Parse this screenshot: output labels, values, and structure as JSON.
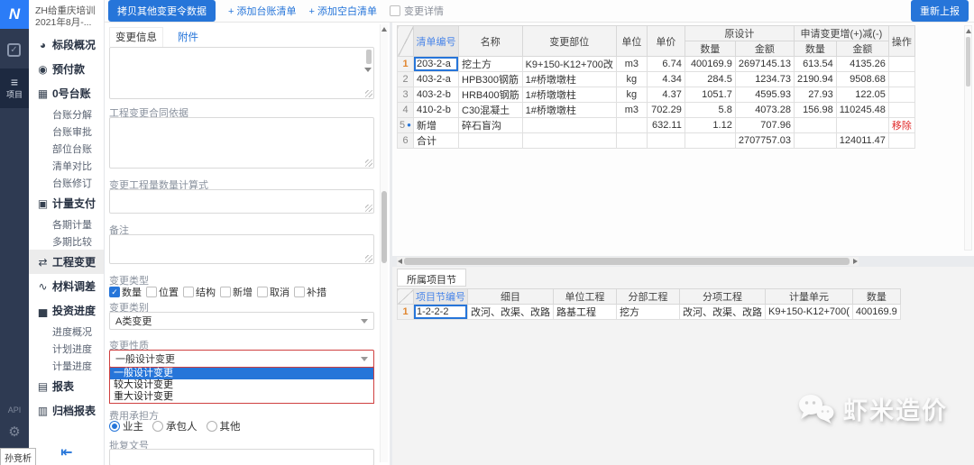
{
  "colors": {
    "accent": "#2675d9",
    "danger": "#e02a2a",
    "active_row_no": "#e0862f"
  },
  "rail": {
    "logo_glyph": "N",
    "project_label": "项目",
    "api_label": "API",
    "user_tooltip": "孙竞析"
  },
  "sidebar": {
    "project_name_line1": "ZH给重庆培训",
    "project_name_line2": "2021年8月-...",
    "items": [
      {
        "id": "section-overview",
        "label": "标段概况",
        "type": "section",
        "icon": "pie-chart-icon",
        "glyph": "◕"
      },
      {
        "id": "advance-payment",
        "label": "预付款",
        "type": "section",
        "icon": "eye-icon",
        "glyph": "◉"
      },
      {
        "id": "ledger-0",
        "label": "0号台账",
        "type": "section",
        "icon": "ledger-icon",
        "glyph": "▦"
      },
      {
        "id": "ledger-breakdown",
        "label": "台账分解",
        "type": "sub"
      },
      {
        "id": "ledger-review",
        "label": "台账审批",
        "type": "sub"
      },
      {
        "id": "part-ledger",
        "label": "部位台账",
        "type": "sub"
      },
      {
        "id": "list-compare",
        "label": "清单对比",
        "type": "sub"
      },
      {
        "id": "ledger-revision",
        "label": "台账修订",
        "type": "sub"
      },
      {
        "id": "measurement-payment",
        "label": "计量支付",
        "type": "section",
        "icon": "calendar-icon",
        "glyph": "▣"
      },
      {
        "id": "period-measurement",
        "label": "各期计量",
        "type": "sub"
      },
      {
        "id": "multi-period-compare",
        "label": "多期比较",
        "type": "sub"
      },
      {
        "id": "engineering-change",
        "label": "工程变更",
        "type": "section",
        "icon": "swap-icon",
        "glyph": "⇄",
        "active": true
      },
      {
        "id": "material-adjustment",
        "label": "材料调差",
        "type": "section",
        "icon": "line-chart-icon",
        "glyph": "∿"
      },
      {
        "id": "investment-progress",
        "label": "投资进度",
        "type": "section",
        "icon": "bar-chart-icon",
        "glyph": "▅"
      },
      {
        "id": "progress-overview",
        "label": "进度概况",
        "type": "sub"
      },
      {
        "id": "plan-progress",
        "label": "计划进度",
        "type": "sub"
      },
      {
        "id": "measurement-progress",
        "label": "计量进度",
        "type": "sub"
      },
      {
        "id": "reports",
        "label": "报表",
        "type": "section",
        "icon": "report-icon",
        "glyph": "▤"
      },
      {
        "id": "archived-reports",
        "label": "归档报表",
        "type": "section",
        "icon": "archive-icon",
        "glyph": "▥"
      }
    ]
  },
  "toolbar": {
    "copy_button": "拷贝其他变更令数据",
    "add_ledger_link": "+ 添加台账清单",
    "add_blank_link": "+ 添加空白清单",
    "detail_checkbox": "变更详情",
    "resubmit_button": "重新上报"
  },
  "form": {
    "tabs": {
      "info": "变更信息",
      "attachment": "附件"
    },
    "contract_basis_label": "工程变更合同依据",
    "quantity_formula_label": "变更工程量数量计算式",
    "remark_label": "备注",
    "change_type_label": "变更类型",
    "change_types": [
      {
        "label": "数量",
        "checked": true
      },
      {
        "label": "位置",
        "checked": false
      },
      {
        "label": "结构",
        "checked": false
      },
      {
        "label": "新增",
        "checked": false
      },
      {
        "label": "取消",
        "checked": false
      },
      {
        "label": "补措",
        "checked": false
      }
    ],
    "change_category_label": "变更类别",
    "change_category_value": "A类变更",
    "change_nature_label": "变更性质",
    "change_nature_value": "一般设计变更",
    "change_nature_options": [
      {
        "label": "一般设计变更",
        "selected": true
      },
      {
        "label": "较大设计变更",
        "selected": false
      },
      {
        "label": "重大设计变更",
        "selected": false
      }
    ],
    "cost_bearer_label": "费用承担方",
    "cost_bearers": [
      {
        "label": "业主",
        "selected": true
      },
      {
        "label": "承包人",
        "selected": false
      },
      {
        "label": "其他",
        "selected": false
      }
    ],
    "approval_no_label": "批复文号",
    "approval_no_value": ""
  },
  "list_table": {
    "group_headers": {
      "original": "原设计",
      "requested": "申请变更增(+)减(-)"
    },
    "headers": [
      "清单编号",
      "名称",
      "变更部位",
      "单位",
      "单价",
      "数量",
      "金额",
      "数量",
      "金额",
      "操作"
    ],
    "rows": [
      {
        "no": "1",
        "active": true,
        "selected_cell": 0,
        "cells": [
          "203-2-a",
          "挖土方",
          "K9+150-K12+700改",
          "m3",
          "6.74",
          "400169.9",
          "2697145.13",
          "613.54",
          "4135.26",
          ""
        ]
      },
      {
        "no": "2",
        "cells": [
          "403-2-a",
          "HPB300钢筋",
          "1#桥墩墩柱",
          "kg",
          "4.34",
          "284.5",
          "1234.73",
          "2190.94",
          "9508.68",
          ""
        ]
      },
      {
        "no": "3",
        "cells": [
          "403-2-b",
          "HRB400钢筋",
          "1#桥墩墩柱",
          "kg",
          "4.37",
          "1051.7",
          "4595.93",
          "27.93",
          "122.05",
          ""
        ]
      },
      {
        "no": "4",
        "cells": [
          "410-2-b",
          "C30混凝土",
          "1#桥墩墩柱",
          "m3",
          "702.29",
          "5.8",
          "4073.28",
          "156.98",
          "110245.48",
          ""
        ]
      },
      {
        "no": "5",
        "dot": true,
        "remove": true,
        "cells": [
          "新增",
          "碎石盲沟",
          "",
          "",
          "632.11",
          "1.12",
          "707.96",
          "",
          "",
          "移除"
        ]
      },
      {
        "no": "6",
        "cells": [
          "合计",
          "",
          "",
          "",
          "",
          "",
          "2707757.03",
          "",
          "124011.47",
          ""
        ]
      }
    ]
  },
  "project_node": {
    "tab": "所属项目节",
    "headers": [
      "项目节编号",
      "细目",
      "单位工程",
      "分部工程",
      "分项工程",
      "计量单元",
      "数量"
    ],
    "rows": [
      {
        "no": "1",
        "active": true,
        "selected_cell": 0,
        "cells": [
          "1-2-2-2",
          "改河、改渠、改路",
          "路基工程",
          "挖方",
          "改河、改渠、改路",
          "K9+150-K12+700(",
          "400169.9"
        ]
      }
    ]
  },
  "watermark": {
    "text": "虾米造价"
  }
}
